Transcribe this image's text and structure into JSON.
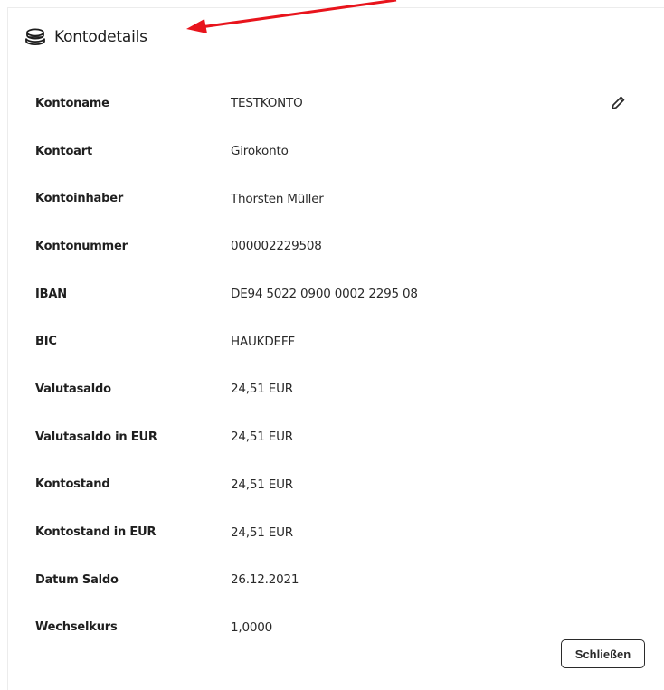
{
  "dialog": {
    "title": "Kontodetails",
    "title_icon": "coin-stack-icon",
    "edit_icon": "pencil-icon",
    "close_label": "Schließen"
  },
  "fields": [
    {
      "label": "Kontoname",
      "value": "TESTKONTO"
    },
    {
      "label": "Kontoart",
      "value": "Girokonto"
    },
    {
      "label": "Kontoinhaber",
      "value": "Thorsten Müller"
    },
    {
      "label": "Kontonummer",
      "value": "000002229508"
    },
    {
      "label": "IBAN",
      "value": "DE94 5022 0900 0002 2295 08"
    },
    {
      "label": "BIC",
      "value": "HAUKDEFF"
    },
    {
      "label": "Valutasaldo",
      "value": "24,51 EUR"
    },
    {
      "label": "Valutasaldo in EUR",
      "value": "24,51 EUR"
    },
    {
      "label": "Kontostand",
      "value": "24,51 EUR"
    },
    {
      "label": "Kontostand in EUR",
      "value": "24,51 EUR"
    },
    {
      "label": "Datum Saldo",
      "value": "26.12.2021"
    },
    {
      "label": "Wechselkurs",
      "value": "1,0000"
    }
  ],
  "colors": {
    "annotation_arrow": "#e8141c",
    "text": "#1f1f1f",
    "button_border": "#2a2a2a"
  }
}
